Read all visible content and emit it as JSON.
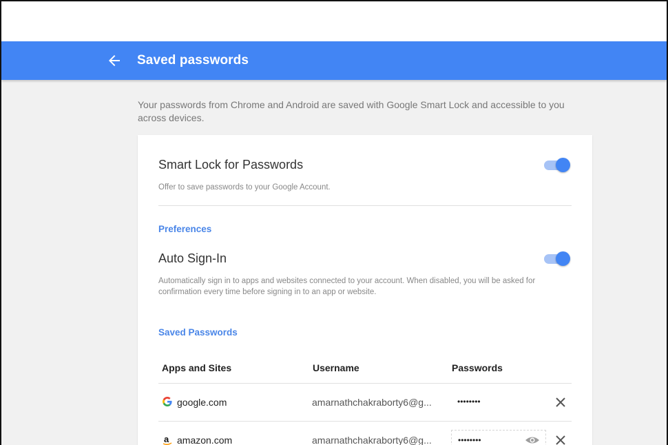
{
  "header": {
    "title": "Saved passwords",
    "back_icon": "arrow-back-icon"
  },
  "intro": "Your passwords from Chrome and Android are saved with Google Smart Lock and accessible to you across devices.",
  "smart_lock": {
    "title": "Smart Lock for Passwords",
    "description": "Offer to save passwords to your Google Account.",
    "enabled": true
  },
  "preferences": {
    "heading": "Preferences",
    "auto_signin": {
      "title": "Auto Sign-In",
      "description": "Automatically sign in to apps and websites connected to your account. When disabled, you will be asked for confirmation every time before signing in to an app or website.",
      "enabled": true
    }
  },
  "saved_passwords": {
    "heading": "Saved Passwords",
    "columns": [
      "Apps and Sites",
      "Username",
      "Passwords"
    ],
    "rows": [
      {
        "icon": "google-g-icon",
        "icon_glyph": "G",
        "site": "google.com",
        "username": "amarnathchakraborty6@g...",
        "password": "••••••••"
      },
      {
        "icon": "amazon-a-icon",
        "icon_glyph": "a",
        "site": "amazon.com",
        "username": "amarnathchakraborty6@g...",
        "password": "••••••••"
      }
    ]
  },
  "colors": {
    "accent": "#4285f4",
    "section_heading": "#4a86e8",
    "toggle_track": "#a7c3f6"
  }
}
